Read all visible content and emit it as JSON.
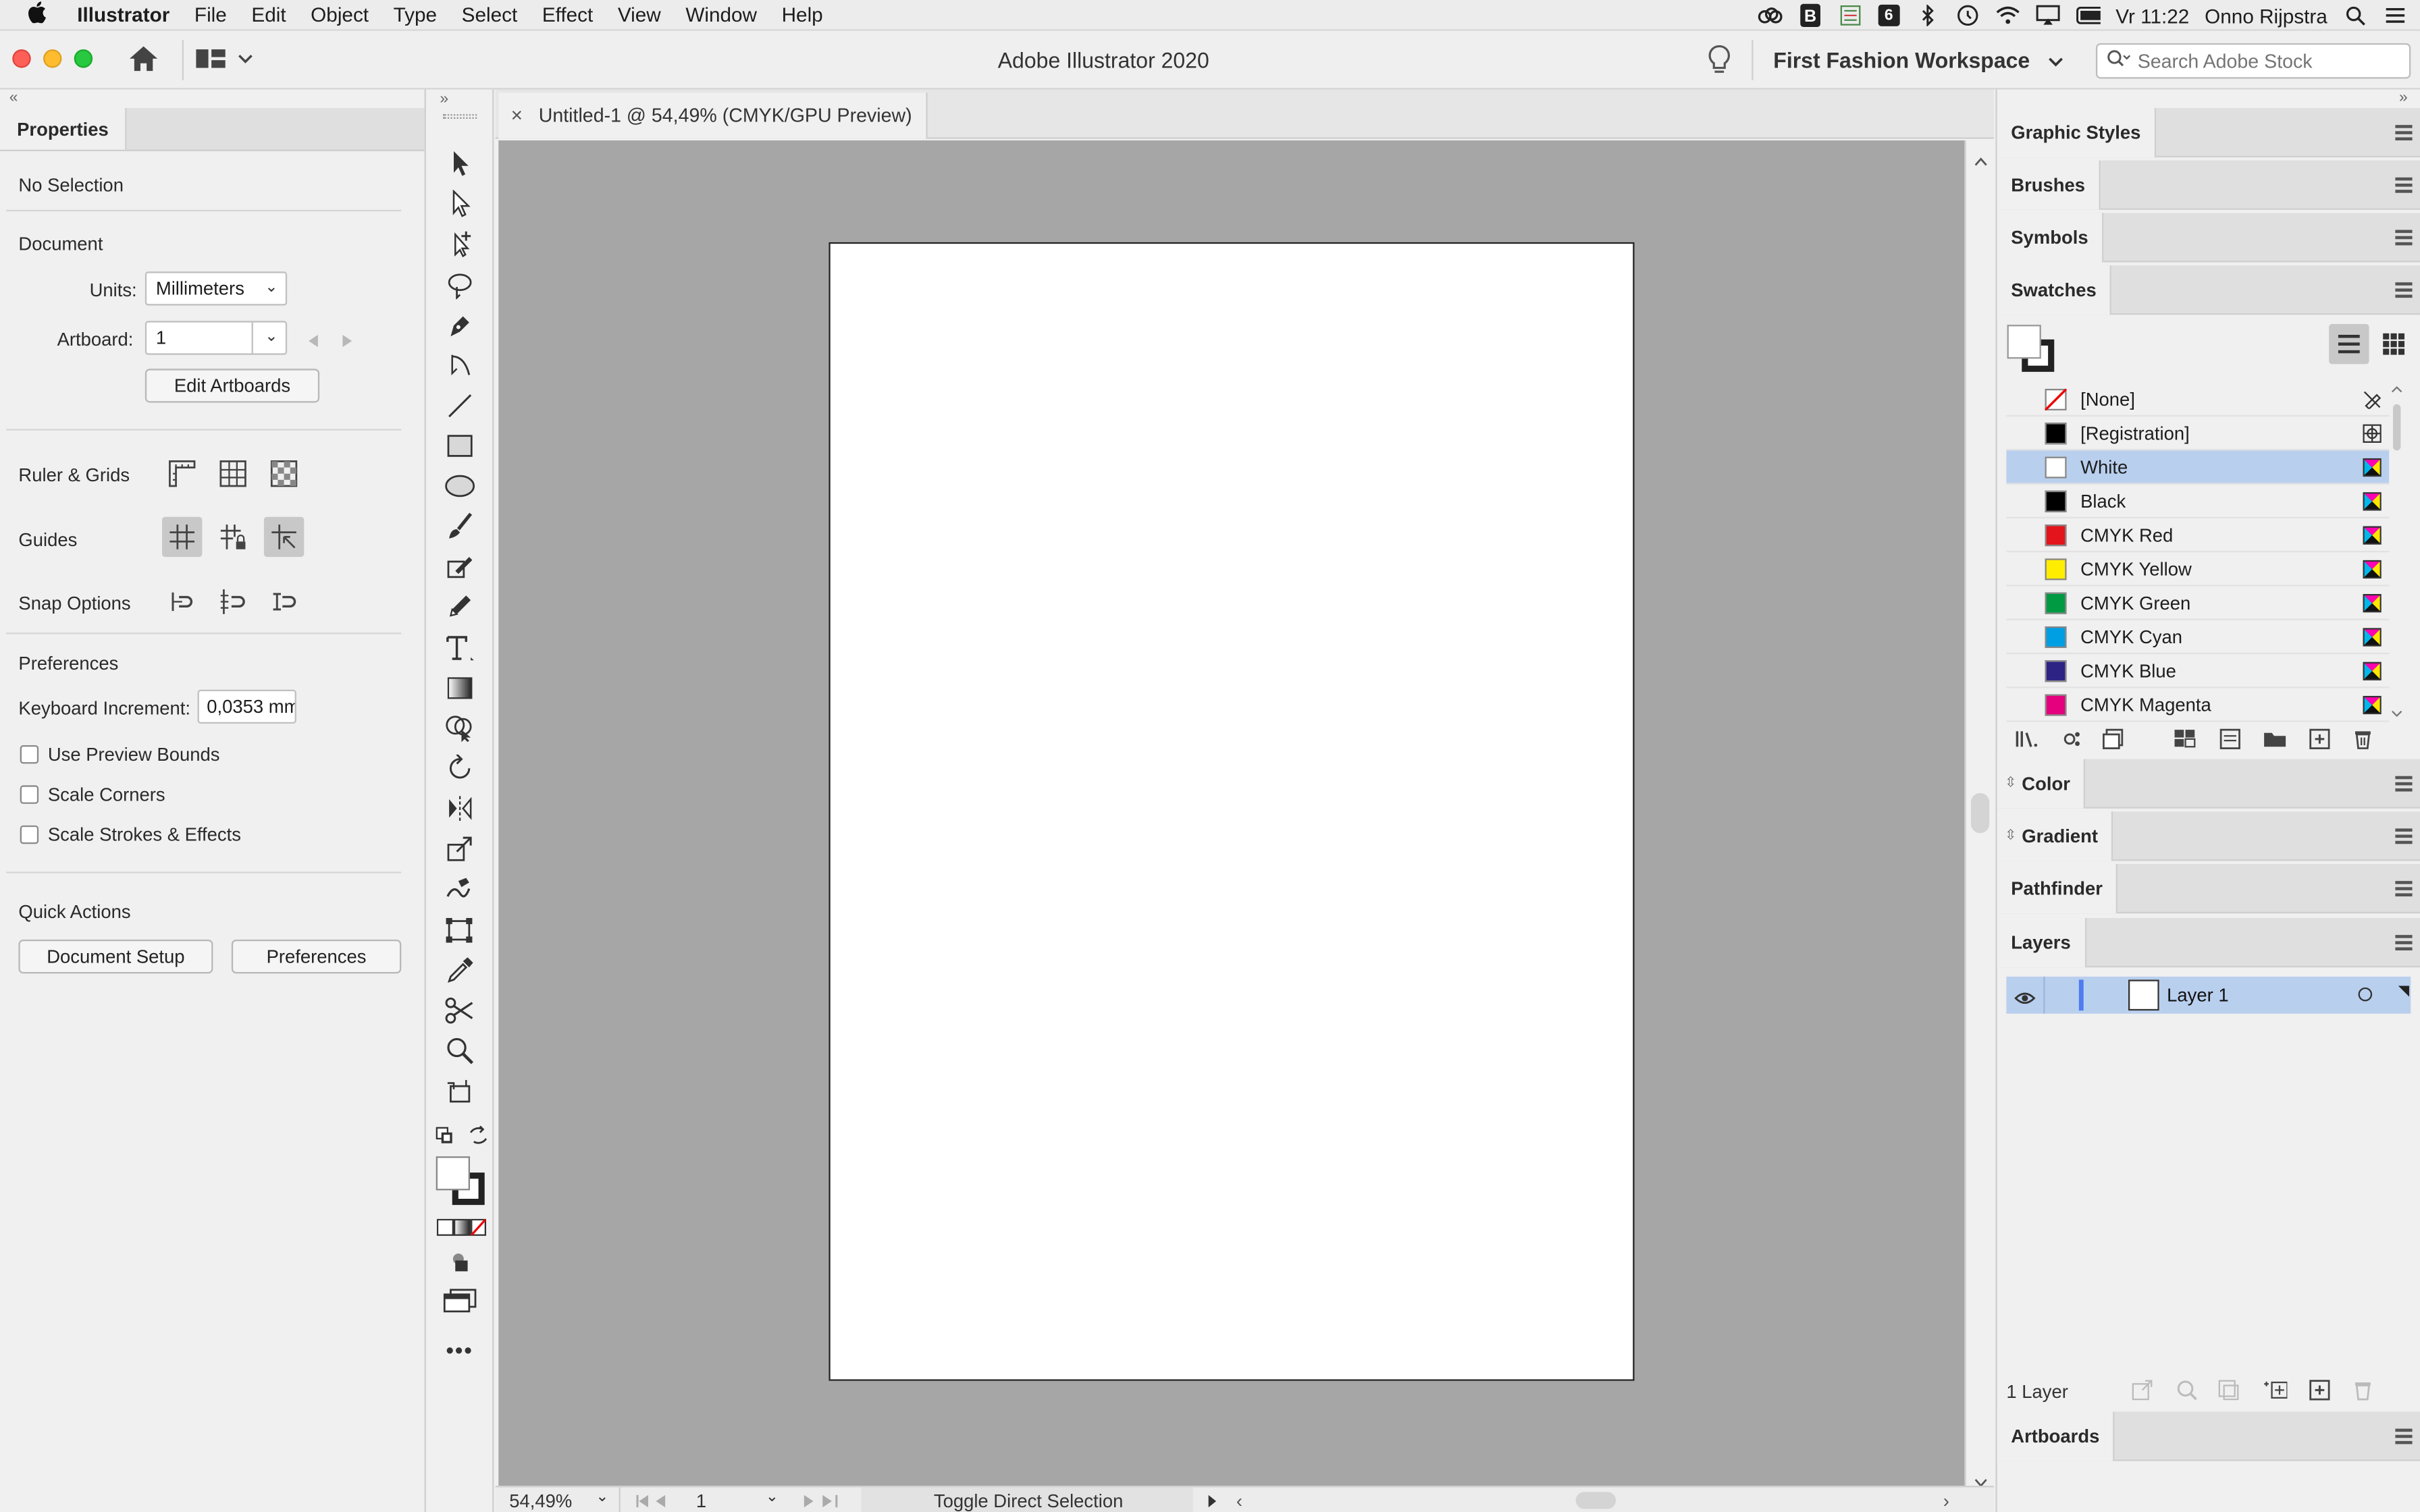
{
  "menubar": {
    "app_name": "Illustrator",
    "items": [
      "File",
      "Edit",
      "Object",
      "Type",
      "Select",
      "Effect",
      "View",
      "Window",
      "Help"
    ],
    "clock": "Vr 11:22",
    "user": "Onno Rijpstra",
    "status_icons": [
      "creative-cloud-icon",
      "bbedit-icon",
      "menu-list-icon",
      "calendar-icon",
      "bluetooth-icon",
      "time-machine-icon",
      "wifi-icon",
      "airplay-icon",
      "battery-icon"
    ],
    "calendar_day": "6"
  },
  "appbar": {
    "title": "Adobe Illustrator 2020",
    "workspace": "First Fashion Workspace",
    "search_placeholder": "Search Adobe Stock"
  },
  "properties": {
    "tab": "Properties",
    "selection": "No Selection",
    "document_heading": "Document",
    "units_label": "Units:",
    "units_value": "Millimeters",
    "artboard_label": "Artboard:",
    "artboard_value": "1",
    "edit_artboards": "Edit Artboards",
    "ruler_grids": "Ruler & Grids",
    "guides": "Guides",
    "snap_options": "Snap Options",
    "preferences_heading": "Preferences",
    "keyboard_increment_label": "Keyboard Increment:",
    "keyboard_increment_value": "0,0353 mm",
    "use_preview_bounds": "Use Preview Bounds",
    "scale_corners": "Scale Corners",
    "scale_strokes": "Scale Strokes & Effects",
    "quick_actions": "Quick Actions",
    "document_setup": "Document Setup",
    "preferences_button": "Preferences"
  },
  "document": {
    "tab_title": "Untitled-1 @ 54,49% (CMYK/GPU Preview)",
    "zoom": "54,49%",
    "artboard_nav": "1",
    "status_text": "Toggle Direct Selection"
  },
  "panels": {
    "graphic_styles": "Graphic Styles",
    "brushes": "Brushes",
    "symbols": "Symbols",
    "swatches": "Swatches",
    "color": "Color",
    "gradient": "Gradient",
    "pathfinder": "Pathfinder",
    "layers": "Layers",
    "artboards": "Artboards"
  },
  "swatches": [
    {
      "name": "[None]",
      "color": "none",
      "selected": false
    },
    {
      "name": "[Registration]",
      "color": "#000000",
      "selected": false
    },
    {
      "name": "White",
      "color": "#ffffff",
      "selected": true
    },
    {
      "name": "Black",
      "color": "#000000",
      "selected": false
    },
    {
      "name": "CMYK Red",
      "color": "#e3141b",
      "selected": false
    },
    {
      "name": "CMYK Yellow",
      "color": "#ffed00",
      "selected": false
    },
    {
      "name": "CMYK Green",
      "color": "#009a43",
      "selected": false
    },
    {
      "name": "CMYK Cyan",
      "color": "#009fe3",
      "selected": false
    },
    {
      "name": "CMYK Blue",
      "color": "#2d2384",
      "selected": false
    },
    {
      "name": "CMYK Magenta",
      "color": "#e5007d",
      "selected": false
    }
  ],
  "layers": {
    "items": [
      {
        "name": "Layer 1",
        "color": "#4f7cf0"
      }
    ],
    "count_text": "1 Layer"
  },
  "colors": {
    "selection_highlight": "#b9cfee",
    "canvas": "#a6a6a6"
  }
}
